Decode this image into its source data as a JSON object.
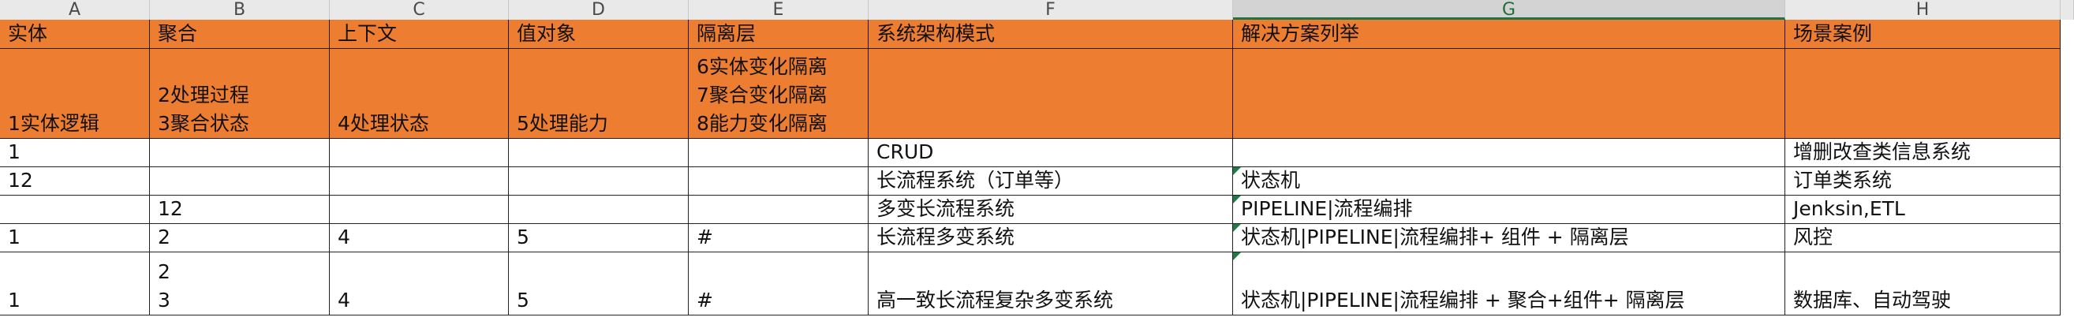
{
  "columns": [
    "A",
    "B",
    "C",
    "D",
    "E",
    "F",
    "G",
    "H"
  ],
  "header_row": [
    "实体",
    "聚合",
    "上下文",
    "值对象",
    "隔离层",
    "系统架构模式",
    "解决方案列举",
    "场景案例"
  ],
  "desc_row": [
    [
      "1实体逻辑"
    ],
    [
      "2处理过程",
      "3聚合状态"
    ],
    [
      "4处理状态"
    ],
    [
      "5处理能力"
    ],
    [
      "6实体变化隔离",
      "7聚合变化隔离",
      "8能力变化隔离"
    ],
    [
      ""
    ],
    [
      ""
    ],
    [
      ""
    ]
  ],
  "rows": [
    [
      [
        "1"
      ],
      [
        ""
      ],
      [
        ""
      ],
      [
        ""
      ],
      [
        ""
      ],
      [
        "CRUD"
      ],
      [
        ""
      ],
      [
        "增删改查类信息系统"
      ]
    ],
    [
      [
        "12"
      ],
      [
        ""
      ],
      [
        ""
      ],
      [
        ""
      ],
      [
        ""
      ],
      [
        "长流程系统（订单等）"
      ],
      [
        "状态机"
      ],
      [
        "订单类系统"
      ]
    ],
    [
      [
        ""
      ],
      [
        "12"
      ],
      [
        ""
      ],
      [
        ""
      ],
      [
        ""
      ],
      [
        "多变长流程系统"
      ],
      [
        "PIPELINE|流程编排"
      ],
      [
        "Jenksin,ETL"
      ]
    ],
    [
      [
        "1"
      ],
      [
        "2"
      ],
      [
        "4"
      ],
      [
        "5"
      ],
      [
        "#"
      ],
      [
        "长流程多变系统"
      ],
      [
        "状态机|PIPELINE|流程编排+ 组件 + 隔离层"
      ],
      [
        "风控"
      ]
    ],
    [
      [
        "1"
      ],
      [
        "2",
        "3"
      ],
      [
        "4"
      ],
      [
        "5"
      ],
      [
        "#"
      ],
      [
        "高一致长流程复杂多变系统"
      ],
      [
        "状态机|PIPELINE|流程编排 + 聚合+组件+ 隔离层"
      ],
      [
        "数据库、自动驾驶"
      ]
    ]
  ],
  "colors": {
    "header_fill": "#ed7d31",
    "grid_line": "#222222",
    "selection": "#217346"
  },
  "selected_column": "G"
}
